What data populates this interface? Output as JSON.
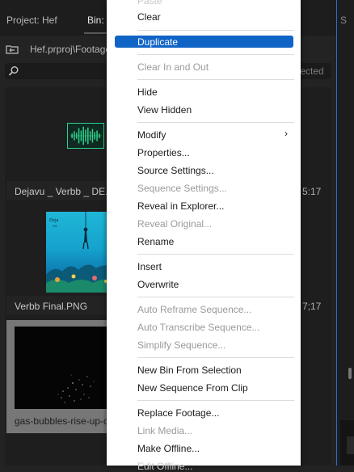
{
  "tabs": {
    "project": "Project: Hef",
    "bin": "Bin: F"
  },
  "path": "Hef.prproj\\Footage",
  "search": {
    "selected_text": "elected"
  },
  "side_panel": {
    "label": "S"
  },
  "items": [
    {
      "name": "Dejavu _ Verbb _ DE...",
      "duration": "5:17"
    },
    {
      "name": "Verbb Final.PNG",
      "duration": "7;17"
    },
    {
      "name": "gas-bubbles-rise-up-cha"
    }
  ],
  "menu": {
    "top_cut": "Paste",
    "clear": "Clear",
    "duplicate": "Duplicate",
    "clear_in_out": "Clear In and Out",
    "hide": "Hide",
    "view_hidden": "View Hidden",
    "modify": "Modify",
    "submenu_arrow": "›",
    "properties": "Properties...",
    "source_settings": "Source Settings...",
    "sequence_settings": "Sequence Settings...",
    "reveal_in_explorer": "Reveal in Explorer...",
    "reveal_original": "Reveal Original...",
    "rename": "Rename",
    "insert": "Insert",
    "overwrite": "Overwrite",
    "auto_reframe": "Auto Reframe Sequence...",
    "auto_transcribe": "Auto Transcribe Sequence...",
    "simplify": "Simplify Sequence...",
    "new_bin_from_selection": "New Bin From Selection",
    "new_sequence_from_clip": "New Sequence From Clip",
    "replace_footage": "Replace Footage...",
    "link_media": "Link Media...",
    "make_offline": "Make Offline...",
    "bottom_cut": "Edit Offline..."
  },
  "colors": {
    "accent": "#0f64c6",
    "waveform": "#2fd08a",
    "panel_border": "#2d6ad1"
  }
}
